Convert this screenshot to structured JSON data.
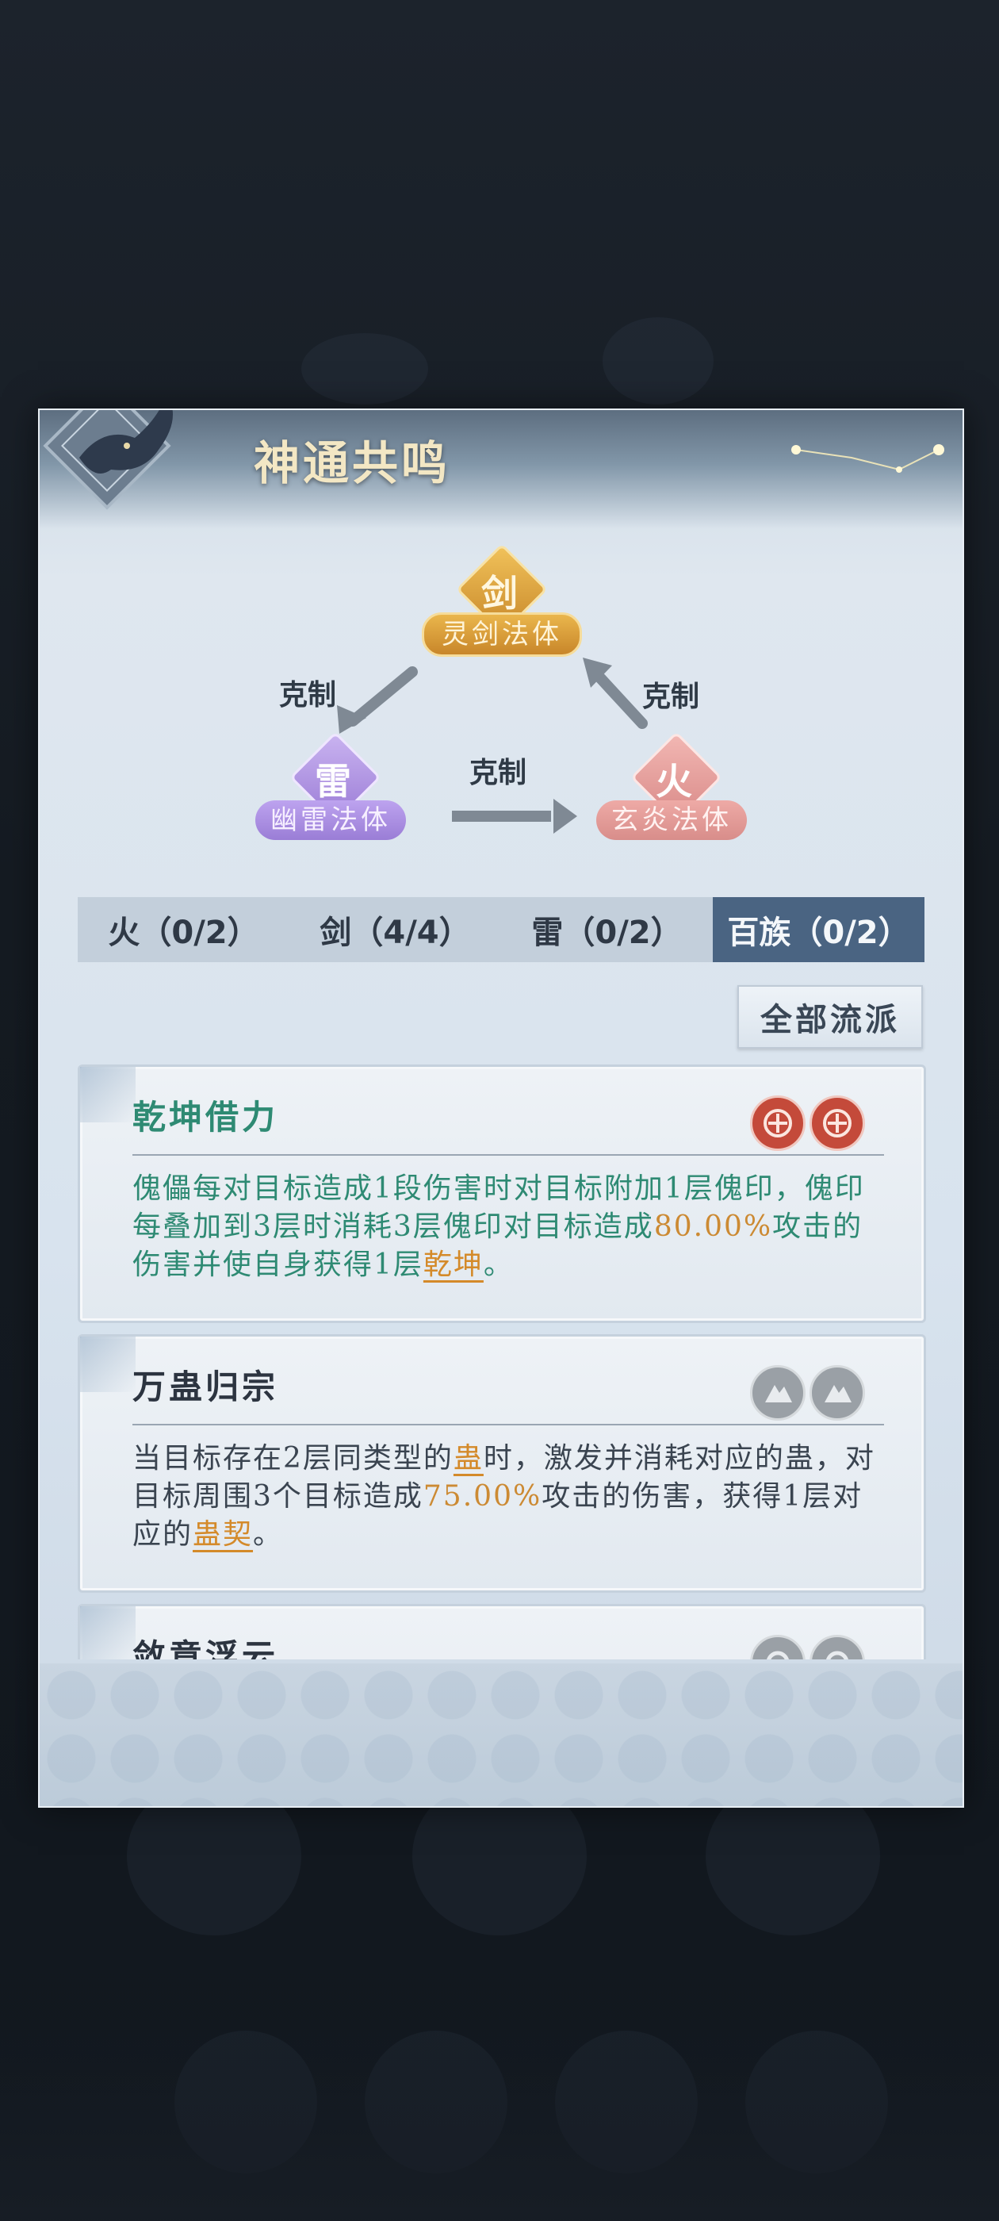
{
  "panel": {
    "title": "神通共鸣"
  },
  "diagram": {
    "top": {
      "glyph": "剑",
      "label": "灵剑法体",
      "color": "#d9a23a"
    },
    "left": {
      "glyph": "雷",
      "label": "幽雷法体",
      "color": "#a889d8"
    },
    "right": {
      "glyph": "火",
      "label": "玄炎法体",
      "color": "#e39a98"
    },
    "relation_label": "克制"
  },
  "tabs": [
    {
      "label": "火（0/2）",
      "active": false
    },
    {
      "label": "剑（4/4）",
      "active": false
    },
    {
      "label": "雷（0/2）",
      "active": false
    },
    {
      "label": "百族（0/2）",
      "active": true
    }
  ],
  "all_schools_button": "全部流派",
  "cards": [
    {
      "title": "乾坤借力",
      "title_color": "#2e8a73",
      "badge_icon": "red-seal-icon",
      "text": {
        "p1": "傀儡每对目标造成1段伤害时对目标附加1层傀印，傀印每叠加到3层时消耗3层傀印对目标造成",
        "num": "80.00%",
        "p2": "攻击的伤害并使自身获得1层",
        "kw": "乾坤",
        "p3": "。"
      }
    },
    {
      "title": "万蛊归宗",
      "title_color": "#2c3440",
      "badge_icon": "grey-mountain-icon",
      "text": {
        "p1": "当目标存在2层同类型的",
        "kw1": "蛊",
        "p2": "时，激发并消耗对应的蛊，对目标周围3个目标造成",
        "num": "75.00%",
        "p3": "攻击的伤害，获得1层对应的",
        "kw2": "蛊契",
        "p4": "。"
      }
    },
    {
      "title": "敛意浮云",
      "title_color": "#2c3440",
      "badge_icon": "grey-swirl-icon"
    }
  ]
}
